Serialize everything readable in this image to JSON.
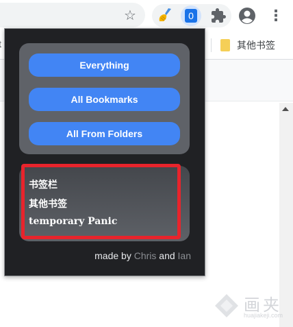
{
  "toolbar": {
    "extension_badge": "0"
  },
  "bookmarks_bar": {
    "cut_text": "t",
    "other_bookmarks": "其他书签"
  },
  "popup": {
    "buttons": [
      "Everything",
      "All Bookmarks",
      "All From Folders"
    ],
    "items": [
      "书签栏",
      "其他书签",
      "temporary Panic"
    ],
    "credit": {
      "prefix": "made by ",
      "author1": "Chris",
      "conjunction": " and ",
      "author2": "Ian"
    }
  },
  "watermark": {
    "title": "画夹",
    "url": "huajiakeji.com"
  },
  "colors": {
    "button_blue": "#4285f4",
    "popup_bg": "#202124",
    "highlight_red": "#e8242c"
  }
}
